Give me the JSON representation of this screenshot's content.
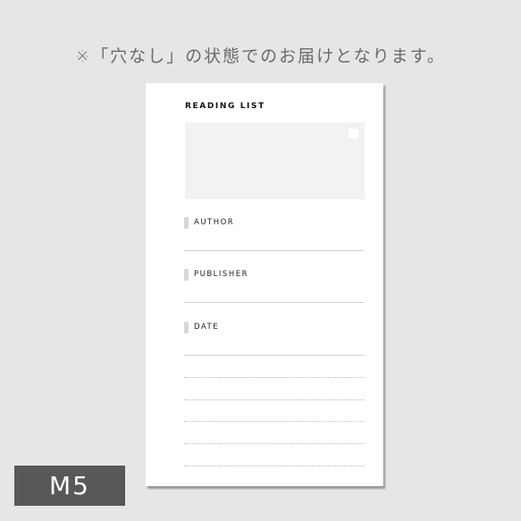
{
  "notice": "※「穴なし」の状態でのお届けとなります。",
  "card": {
    "title": "READING LIST",
    "fields": [
      {
        "label": "AUTHOR"
      },
      {
        "label": "PUBLISHER"
      },
      {
        "label": "DATE"
      }
    ],
    "note_lines": 5
  },
  "size_badge": "M5"
}
